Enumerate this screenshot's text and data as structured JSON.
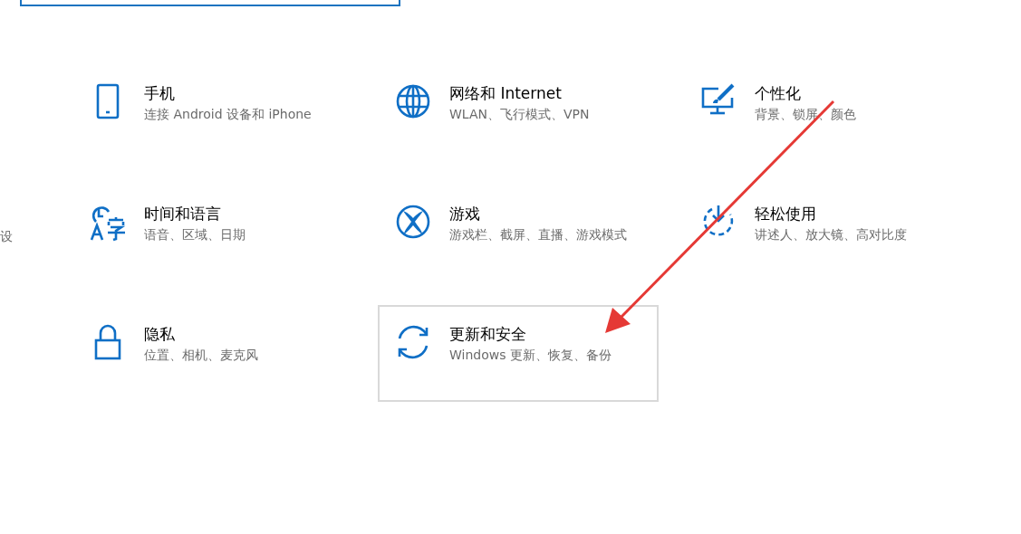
{
  "left_fragment": "设",
  "tiles": [
    {
      "kind": "phone",
      "title": "手机",
      "subtitle": "连接 Android 设备和 iPhone",
      "selected": false
    },
    {
      "kind": "globe",
      "title": "网络和 Internet",
      "subtitle": "WLAN、飞行模式、VPN",
      "selected": false
    },
    {
      "kind": "personalize",
      "title": "个性化",
      "subtitle": "背景、锁屏、颜色",
      "selected": false
    },
    {
      "kind": "time-language",
      "title": "时间和语言",
      "subtitle": "语音、区域、日期",
      "selected": false
    },
    {
      "kind": "xbox",
      "title": "游戏",
      "subtitle": "游戏栏、截屏、直播、游戏模式",
      "selected": false
    },
    {
      "kind": "accessibility",
      "title": "轻松使用",
      "subtitle": "讲述人、放大镜、高对比度",
      "selected": false
    },
    {
      "kind": "lock",
      "title": "隐私",
      "subtitle": "位置、相机、麦克风",
      "selected": false
    },
    {
      "kind": "sync",
      "title": "更新和安全",
      "subtitle": "Windows 更新、恢复、备份",
      "selected": true
    }
  ]
}
